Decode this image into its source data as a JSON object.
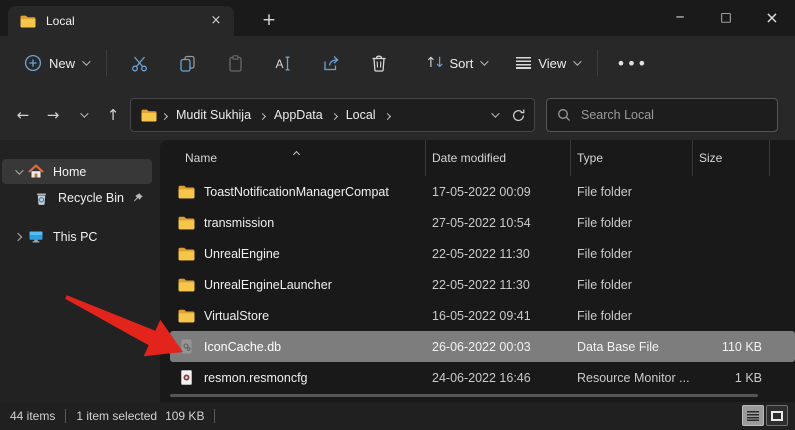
{
  "tab": {
    "title": "Local",
    "close_glyph": "×",
    "new_tab_glyph": "+"
  },
  "window_controls": {
    "minimize": "─",
    "maximize": "□",
    "close": "×"
  },
  "toolbar": {
    "new_label": "New",
    "sort_label": "Sort",
    "view_label": "View",
    "more_glyph": "•••",
    "sort_up_glyph": "↑",
    "sort_down_glyph": "↓"
  },
  "nav": {
    "back_glyph": "←",
    "forward_glyph": "→",
    "up_glyph": "↑"
  },
  "address": {
    "breadcrumbs": [
      "Mudit Sukhija",
      "AppData",
      "Local"
    ]
  },
  "search": {
    "placeholder": "Search Local"
  },
  "sidebar": {
    "items": [
      {
        "label": "Home",
        "icon": "home-icon"
      },
      {
        "label": "Recycle Bin",
        "icon": "recycle-bin-icon"
      },
      {
        "label": "This PC",
        "icon": "this-pc-icon"
      }
    ]
  },
  "files": {
    "columns": [
      "Name",
      "Date modified",
      "Type",
      "Size"
    ],
    "rows": [
      {
        "name": "ToastNotificationManagerCompat",
        "date": "17-05-2022 00:09",
        "type": "File folder",
        "size": "",
        "icon": "folder",
        "selected": false
      },
      {
        "name": "transmission",
        "date": "27-05-2022 10:54",
        "type": "File folder",
        "size": "",
        "icon": "folder",
        "selected": false
      },
      {
        "name": "UnrealEngine",
        "date": "22-05-2022 11:30",
        "type": "File folder",
        "size": "",
        "icon": "folder",
        "selected": false
      },
      {
        "name": "UnrealEngineLauncher",
        "date": "22-05-2022 11:30",
        "type": "File folder",
        "size": "",
        "icon": "folder",
        "selected": false
      },
      {
        "name": "VirtualStore",
        "date": "16-05-2022 09:41",
        "type": "File folder",
        "size": "",
        "icon": "folder",
        "selected": false
      },
      {
        "name": "IconCache.db",
        "date": "26-06-2022 00:03",
        "type": "Data Base File",
        "size": "110 KB",
        "icon": "db",
        "selected": true
      },
      {
        "name": "resmon.resmoncfg",
        "date": "24-06-2022 16:46",
        "type": "Resource Monitor ...",
        "size": "1 KB",
        "icon": "resmon",
        "selected": false
      }
    ]
  },
  "statusbar": {
    "items_count": "44 items",
    "selected_text": "1 item selected",
    "selected_size": "109 KB"
  },
  "colors": {
    "accent_blue": "#6ba3d6",
    "selection_gray": "#7d7d7d",
    "folder_yellow": "#f6c64b",
    "arrow_red": "#e3241c"
  }
}
